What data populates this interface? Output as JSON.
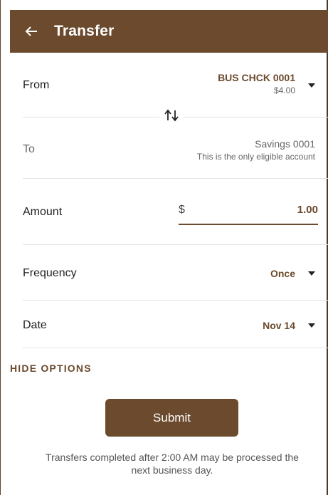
{
  "appbar": {
    "title": "Transfer",
    "back_icon": "arrow-left-icon",
    "color": "#6b4a2e"
  },
  "from": {
    "label": "From",
    "account": "BUS CHCK 0001",
    "balance": "$4.00"
  },
  "swap": {
    "icon": "swap-vertical-icon"
  },
  "to": {
    "label": "To",
    "account": "Savings 0001",
    "note": "This is the only eligible account"
  },
  "amount": {
    "label": "Amount",
    "currency": "$",
    "value": "1.00"
  },
  "frequency": {
    "label": "Frequency",
    "value": "Once"
  },
  "date": {
    "label": "Date",
    "value": "Nov 14"
  },
  "options": {
    "toggle_label": "HIDE OPTIONS"
  },
  "submit": {
    "label": "Submit"
  },
  "footnote": "Transfers completed after 2:00 AM may be processed the next business day."
}
